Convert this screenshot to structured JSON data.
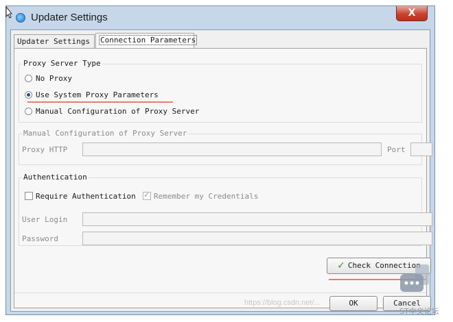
{
  "window": {
    "title": "Updater Settings",
    "close_glyph": "X"
  },
  "tabs": [
    {
      "label": "Updater Settings",
      "selected": false
    },
    {
      "label": "Connection Parameters",
      "selected": true
    }
  ],
  "proxy_type": {
    "legend": "Proxy Server Type",
    "options": [
      {
        "label": "No Proxy",
        "selected": false
      },
      {
        "label": "Use System Proxy Parameters",
        "selected": true
      },
      {
        "label": "Manual Configuration of Proxy Server",
        "selected": false
      }
    ]
  },
  "manual_config": {
    "legend": "Manual Configuration of Proxy Server",
    "proxy_label": "Proxy HTTP",
    "proxy_value": "",
    "port_label": "Port",
    "port_value": ""
  },
  "authentication": {
    "legend": "Authentication",
    "require_label": "Require Authentication",
    "require_checked": false,
    "remember_label": "Remember my Credentials",
    "remember_checked": true,
    "login_label": "User Login",
    "login_value": "",
    "password_label": "Password",
    "password_value": ""
  },
  "buttons": {
    "check_connection": "Check Connection",
    "ok": "OK",
    "cancel": "Cancel"
  },
  "annotations": {
    "underline_color": "#e8433a"
  },
  "overlay": {
    "watermark": "https://blog.csdn.net/...",
    "logo_text": "ST中文论坛"
  }
}
